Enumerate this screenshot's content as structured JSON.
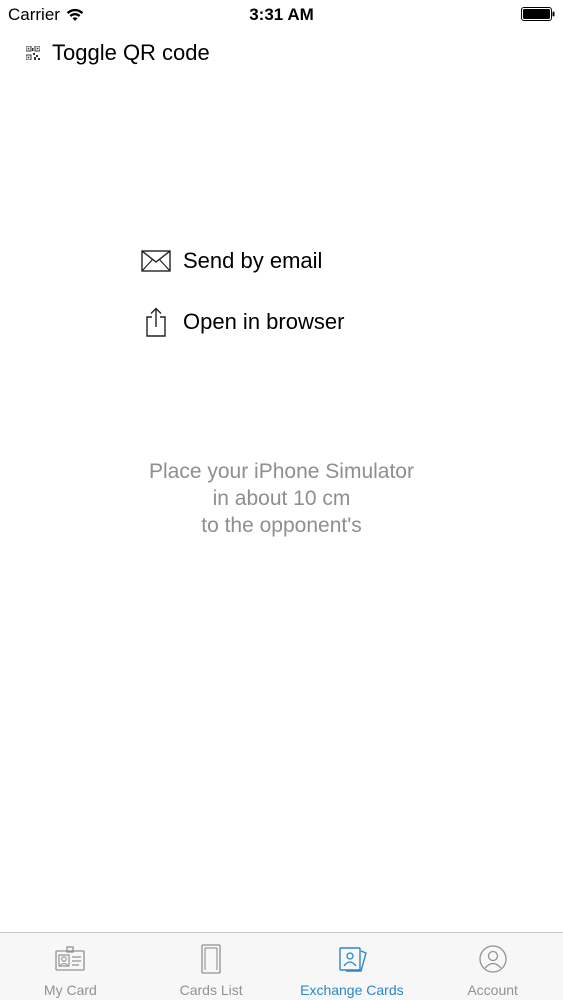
{
  "status_bar": {
    "carrier": "Carrier",
    "time": "3:31 AM"
  },
  "toolbar": {
    "toggle_qr_label": "Toggle QR code"
  },
  "actions": {
    "email_label": "Send by email",
    "browser_label": "Open in browser"
  },
  "hint": {
    "line1": "Place your iPhone Simulator",
    "line2": "in about 10 cm",
    "line3": "to the opponent's"
  },
  "tab_bar": {
    "items": [
      {
        "label": "My Card",
        "icon": "id-card-icon"
      },
      {
        "label": "Cards List",
        "icon": "cards-list-icon"
      },
      {
        "label": "Exchange Cards",
        "icon": "exchange-cards-icon"
      },
      {
        "label": "Account",
        "icon": "account-icon"
      }
    ],
    "active_index": 2
  },
  "colors": {
    "accent": "#2a87c8",
    "inactive_tab": "#929292",
    "hint_text": "#8e8e93",
    "tab_bar_bg": "#f7f7f7"
  }
}
